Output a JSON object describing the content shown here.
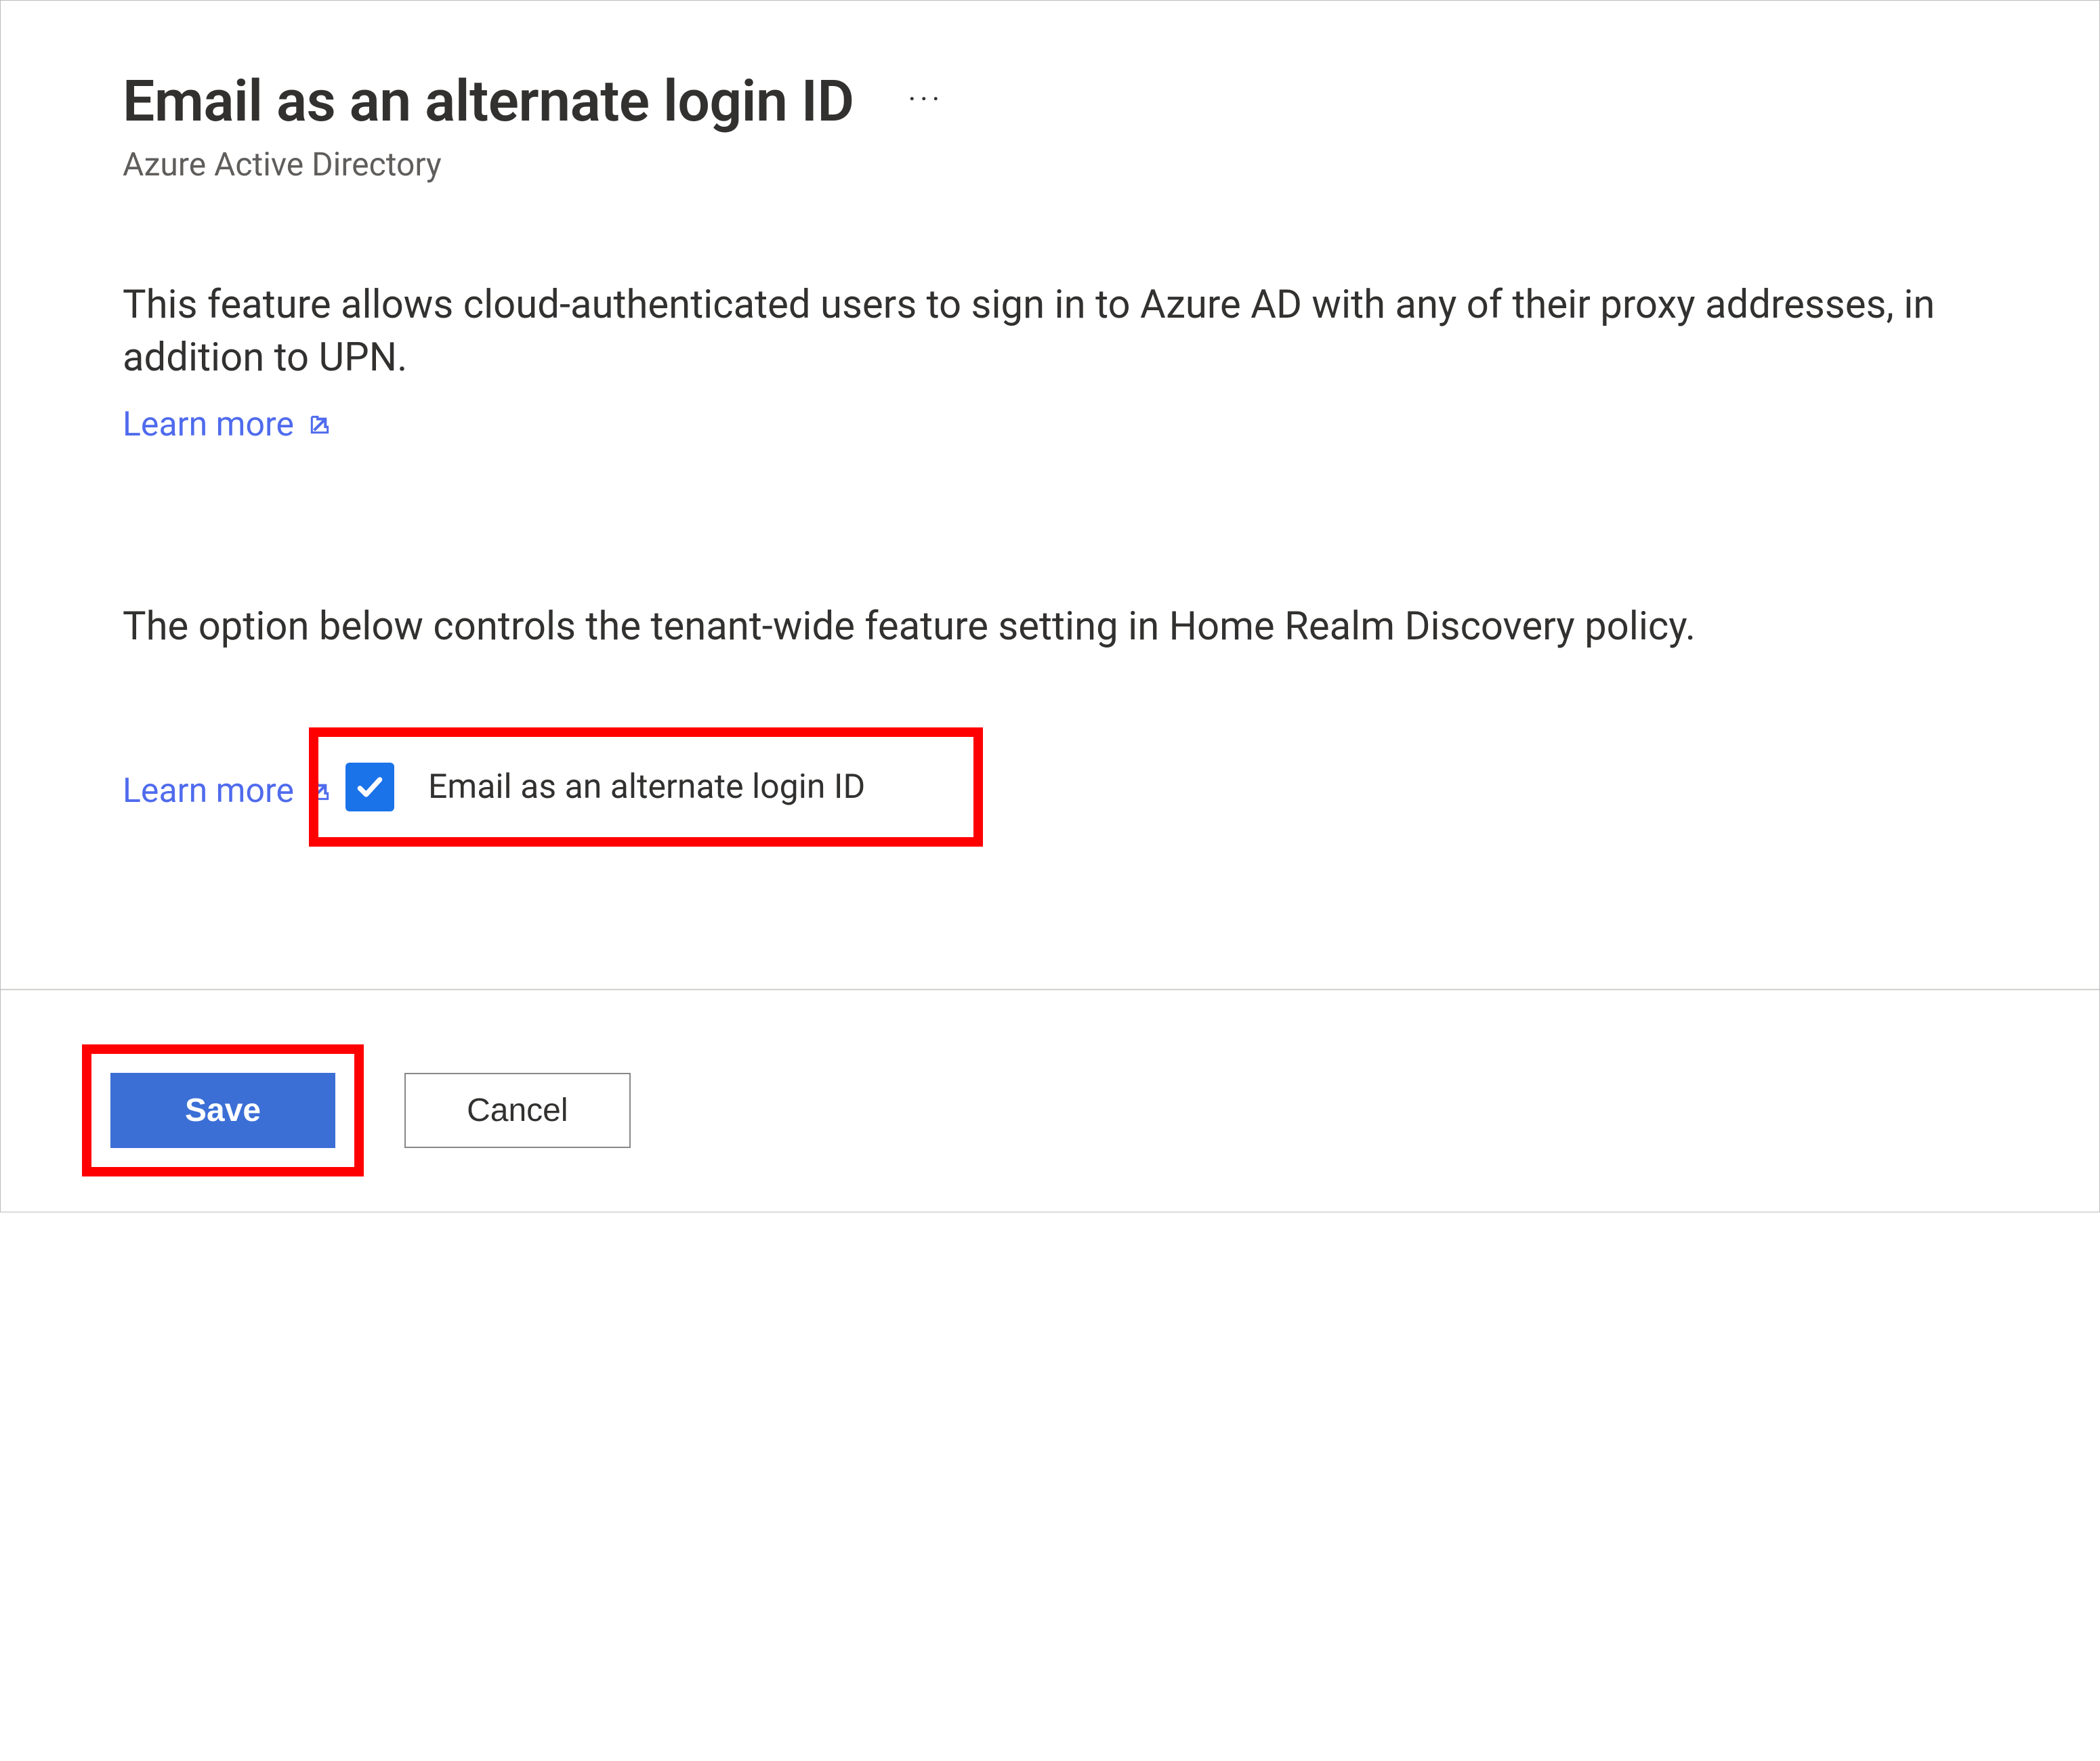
{
  "header": {
    "title": "Email as an alternate login ID",
    "subtitle": "Azure Active Directory"
  },
  "sections": {
    "description1": "This feature allows cloud-authenticated users to sign in to Azure AD with any of their proxy addresses, in addition to UPN.",
    "learn_more_1": "Learn more",
    "description2": "The option below controls the tenant-wide feature setting in Home Realm Discovery policy.",
    "learn_more_2": "Learn more"
  },
  "checkbox": {
    "label": "Email as an alternate login ID",
    "checked": true
  },
  "footer": {
    "save_label": "Save",
    "cancel_label": "Cancel"
  }
}
